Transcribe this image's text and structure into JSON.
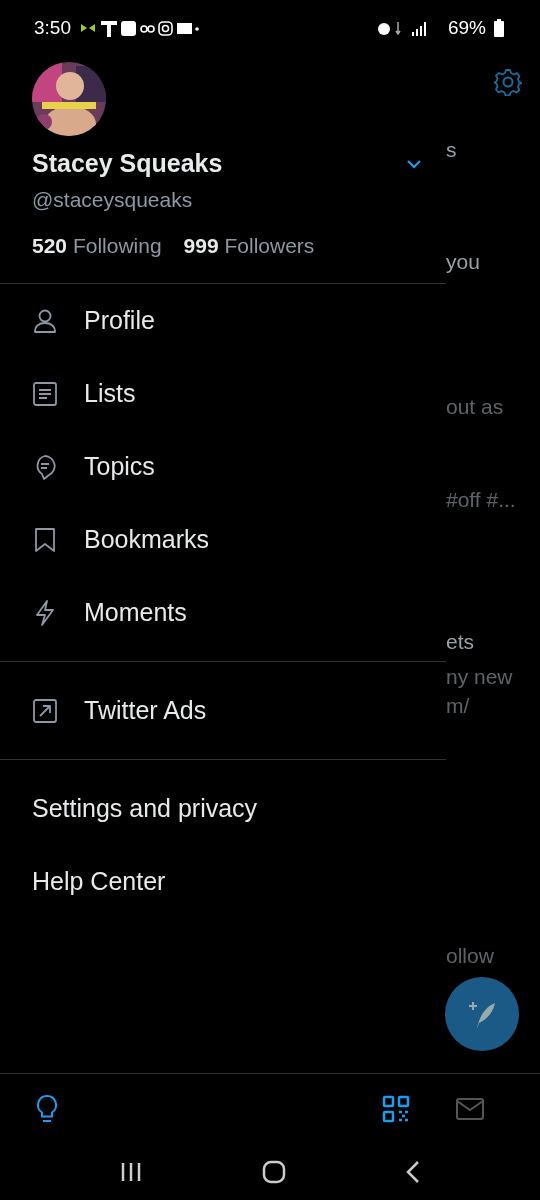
{
  "status_bar": {
    "time": "3:50",
    "battery": "69%"
  },
  "profile": {
    "name": "Stacey Squeaks",
    "handle": "@staceysqueaks",
    "following_count": "520",
    "following_label": "Following",
    "followers_count": "999",
    "followers_label": "Followers"
  },
  "menu": [
    "Profile",
    "Lists",
    "Topics",
    "Bookmarks",
    "Moments"
  ],
  "ads": [
    "Twitter Ads"
  ],
  "links": [
    "Settings and privacy",
    "Help Center"
  ],
  "background_feed": [
    {
      "text": "s",
      "kind": "title"
    },
    {
      "text": "you",
      "kind": "title"
    },
    {
      "text": "out as",
      "kind": "body"
    },
    {
      "text": "#off #...",
      "kind": "body"
    },
    {
      "text": "ets",
      "kind": "title"
    },
    {
      "text": "ny new",
      "kind": "body"
    },
    {
      "text": "m/",
      "kind": "body"
    },
    {
      "text": "ollow",
      "kind": "body"
    }
  ]
}
